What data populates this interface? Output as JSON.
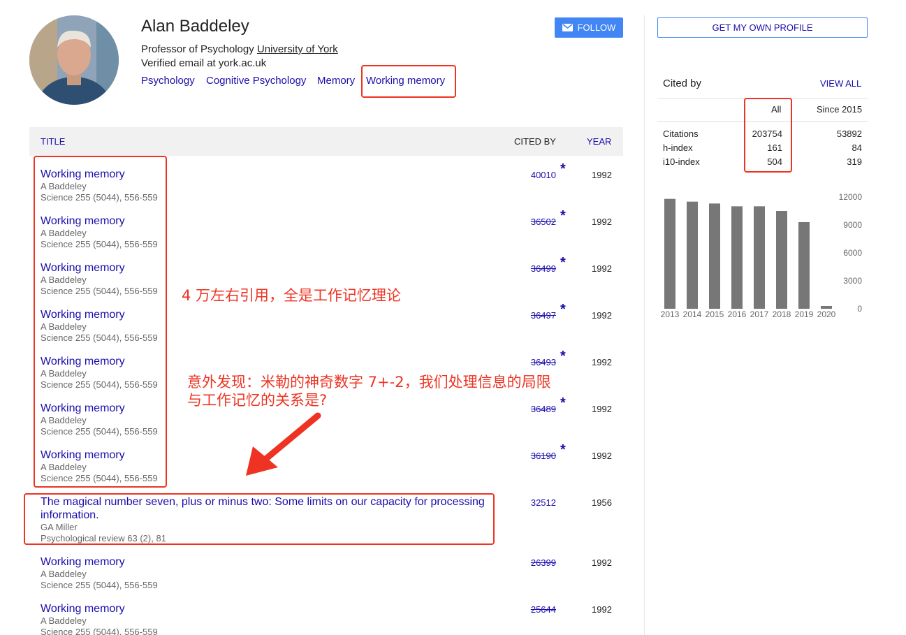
{
  "profile": {
    "name": "Alan Baddeley",
    "affiliation_prefix": "Professor of Psychology ",
    "university": "University of York",
    "email": "Verified email at york.ac.uk",
    "tags": [
      "Psychology",
      "Cognitive Psychology",
      "Memory",
      "Working memory"
    ],
    "follow_label": "FOLLOW",
    "own_profile_label": "GET MY OWN PROFILE"
  },
  "table": {
    "headers": {
      "title": "TITLE",
      "cited_by": "CITED BY",
      "year": "YEAR"
    },
    "rows": [
      {
        "title": "Working memory",
        "authors": "A Baddeley",
        "pub": "Science 255 (5044), 556-559",
        "cited": "40010",
        "merged": false,
        "star": "*",
        "year": "1992"
      },
      {
        "title": "Working memory",
        "authors": "A Baddeley",
        "pub": "Science 255 (5044), 556-559",
        "cited": "36502",
        "merged": true,
        "star": "*",
        "year": "1992"
      },
      {
        "title": "Working memory",
        "authors": "A Baddeley",
        "pub": "Science 255 (5044), 556-559",
        "cited": "36499",
        "merged": true,
        "star": "*",
        "year": "1992"
      },
      {
        "title": "Working memory",
        "authors": "A Baddeley",
        "pub": "Science 255 (5044), 556-559",
        "cited": "36497",
        "merged": true,
        "star": "*",
        "year": "1992"
      },
      {
        "title": "Working memory",
        "authors": "A Baddeley",
        "pub": "Science 255 (5044), 556-559",
        "cited": "36493",
        "merged": true,
        "star": "*",
        "year": "1992"
      },
      {
        "title": "Working memory",
        "authors": "A Baddeley",
        "pub": "Science 255 (5044), 556-559",
        "cited": "36489",
        "merged": true,
        "star": "*",
        "year": "1992"
      },
      {
        "title": "Working memory",
        "authors": "A Baddeley",
        "pub": "Science 255 (5044), 556-559",
        "cited": "36190",
        "merged": true,
        "star": "*",
        "year": "1992"
      },
      {
        "title": "The magical number seven, plus or minus two: Some limits on our capacity for processing information.",
        "authors": "GA Miller",
        "pub": "Psychological review 63 (2), 81",
        "cited": "32512",
        "merged": false,
        "star": "",
        "year": "1956"
      },
      {
        "title": "Working memory",
        "authors": "A Baddeley",
        "pub": "Science 255 (5044), 556-559",
        "cited": "26399",
        "merged": true,
        "star": "",
        "year": "1992"
      },
      {
        "title": "Working memory",
        "authors": "A Baddeley",
        "pub": "Science 255 (5044), 556-559",
        "cited": "25644",
        "merged": true,
        "star": "",
        "year": "1992"
      }
    ]
  },
  "cited_by": {
    "title": "Cited by",
    "view_all": "VIEW ALL",
    "col_all": "All",
    "col_since": "Since 2015",
    "metrics": [
      {
        "label": "Citations",
        "all": "203754",
        "since": "53892"
      },
      {
        "label": "h-index",
        "all": "161",
        "since": "84"
      },
      {
        "label": "i10-index",
        "all": "504",
        "since": "319"
      }
    ]
  },
  "chart_data": {
    "type": "bar",
    "categories": [
      "2013",
      "2014",
      "2015",
      "2016",
      "2017",
      "2018",
      "2019",
      "2020"
    ],
    "values": [
      11800,
      11500,
      11300,
      11000,
      11000,
      10500,
      9300,
      300
    ],
    "ylim": [
      0,
      12000
    ],
    "yticks": [
      "12000",
      "9000",
      "6000",
      "3000",
      "0"
    ],
    "y_axis_side": "right",
    "bar_color": "#777777"
  },
  "annotations": {
    "note1": "4 万左右引用，全是工作记忆理论",
    "note2_line1": "意外发现：米勒的神奇数字 7+-2，我们处理信息的局限",
    "note2_line2": "与工作记忆的关系是?",
    "color": "#ee3322"
  }
}
